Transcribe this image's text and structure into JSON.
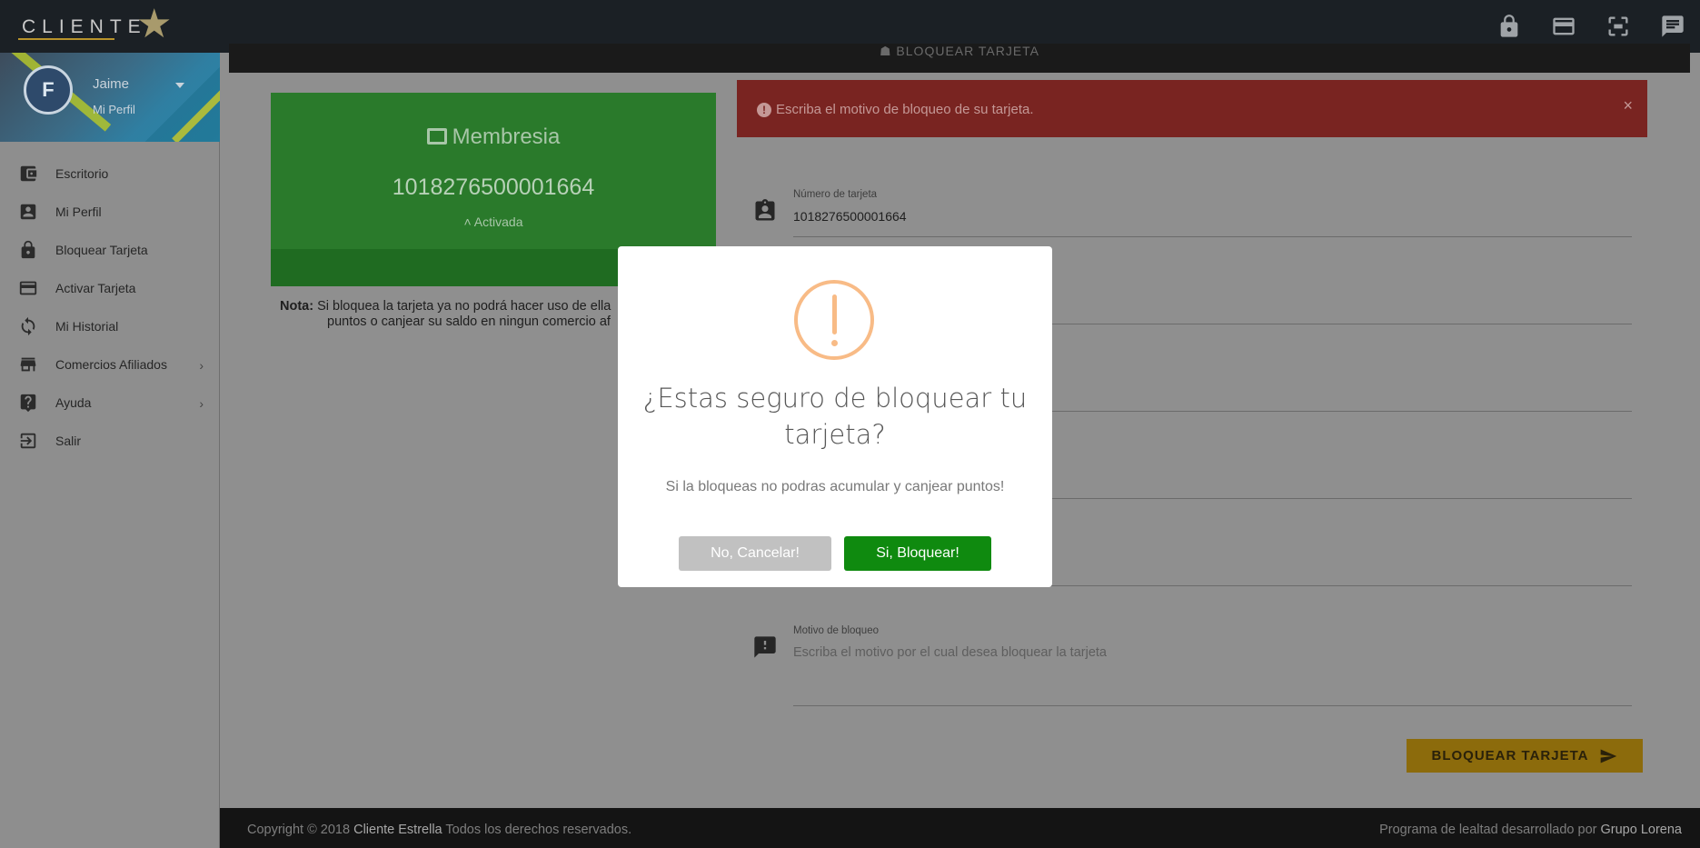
{
  "app": {
    "logo_text": "CLIENTE"
  },
  "topbar": {
    "icons": [
      "lock-icon",
      "credit-card-icon",
      "fullscreen-icon",
      "chat-icon"
    ]
  },
  "profile": {
    "name": "Jaime",
    "link": "Mi Perfil",
    "avatar_letter": "F"
  },
  "menu": {
    "items": [
      {
        "label": "Escritorio",
        "icon": "wallet-icon"
      },
      {
        "label": "Mi Perfil",
        "icon": "user-card-icon"
      },
      {
        "label": "Bloquear Tarjeta",
        "icon": "lock-icon"
      },
      {
        "label": "Activar Tarjeta",
        "icon": "credit-card-icon"
      },
      {
        "label": "Mi Historial",
        "icon": "history-icon"
      },
      {
        "label": "Comercios Afiliados",
        "icon": "store-icon",
        "has_submenu": true
      },
      {
        "label": "Ayuda",
        "icon": "help-icon",
        "has_submenu": true
      },
      {
        "label": "Salir",
        "icon": "logout-icon"
      }
    ]
  },
  "page": {
    "header_title": "☗ BLOQUEAR TARJETA"
  },
  "membership": {
    "title": "Membresia",
    "number": "1018276500001664",
    "status": "˄ Activada"
  },
  "note": {
    "label": "Nota:",
    "line1": "Si bloquea la tarjeta ya no podrá hacer uso de ella",
    "line2": "puntos o canjear su saldo en ningun comercio af"
  },
  "alert": {
    "text": "Escriba el motivo de bloqueo de su tarjeta.",
    "close": "×"
  },
  "form": {
    "card_number_label": "Número de tarjeta",
    "card_number_value": "1018276500001664",
    "reason_label": "Motivo de bloqueo",
    "reason_placeholder": "Escriba el motivo por el cual desea bloquear la tarjeta",
    "submit_label": "BLOQUEAR TARJETA"
  },
  "modal": {
    "title": "¿Estas seguro de bloquear tu tarjeta?",
    "text": "Si la bloqueas no podras acumular y canjear puntos!",
    "cancel_label": "No, Cancelar!",
    "confirm_label": "Si, Bloquear!"
  },
  "footer": {
    "copyright_prefix": "Copyright © 2018",
    "brand": "Cliente Estrella",
    "copyright_suffix": "Todos los derechos reservados.",
    "right_prefix": "Programa de lealtad desarrollado por",
    "right_brand": "Grupo Lorena"
  }
}
